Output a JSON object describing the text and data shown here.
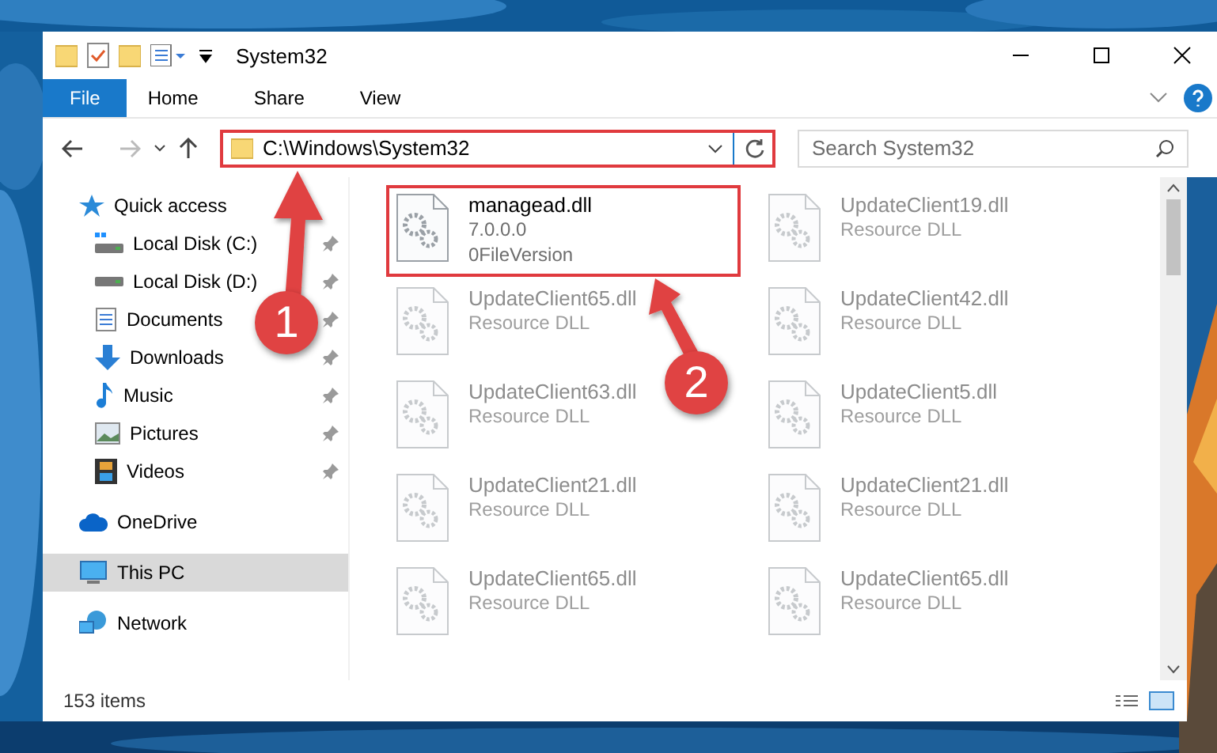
{
  "window": {
    "title": "System32"
  },
  "ribbon_tabs": [
    {
      "label": "File",
      "kind": "menu",
      "selected": false
    },
    {
      "label": "Home",
      "kind": "tab",
      "selected": false
    },
    {
      "label": "Share",
      "kind": "tab",
      "selected": false
    },
    {
      "label": "View",
      "kind": "tab",
      "selected": false
    }
  ],
  "address": {
    "path": "C:\\Windows\\System32",
    "highlighted": true
  },
  "search": {
    "placeholder": "Search System32"
  },
  "sidebar": {
    "items": [
      {
        "label": "Quick access",
        "selected": false,
        "children": [
          {
            "label": "Local Disk (C:)",
            "pinned": true,
            "selected": false
          },
          {
            "label": "Local Disk (D:)",
            "pinned": true,
            "selected": false
          },
          {
            "label": "Documents",
            "pinned": true,
            "selected": false
          },
          {
            "label": "Downloads",
            "pinned": true,
            "selected": false
          },
          {
            "label": "Music",
            "pinned": true,
            "selected": false
          },
          {
            "label": "Pictures",
            "pinned": true,
            "selected": false
          },
          {
            "label": "Videos",
            "pinned": true,
            "selected": false
          }
        ]
      },
      {
        "label": "OneDrive",
        "selected": false
      },
      {
        "label": "This PC",
        "selected": true
      },
      {
        "label": "Network",
        "selected": false
      }
    ]
  },
  "files": [
    {
      "name": "managead.dll",
      "details": [
        "7.0.0.0",
        "0FileVersion"
      ],
      "highlighted": true,
      "blurred": false
    },
    {
      "name": "UpdateClient19.dll",
      "details": [
        "Resource DLL"
      ],
      "highlighted": false,
      "blurred": true
    },
    {
      "name": "UpdateClient65.dll",
      "details": [
        "Resource DLL"
      ],
      "highlighted": false,
      "blurred": true
    },
    {
      "name": "UpdateClient42.dll",
      "details": [
        "Resource DLL"
      ],
      "highlighted": false,
      "blurred": true
    },
    {
      "name": "UpdateClient63.dll",
      "details": [
        "Resource DLL"
      ],
      "highlighted": false,
      "blurred": true
    },
    {
      "name": "UpdateClient5.dll",
      "details": [
        "Resource DLL"
      ],
      "highlighted": false,
      "blurred": true
    },
    {
      "name": "UpdateClient21.dll",
      "details": [
        "Resource DLL"
      ],
      "highlighted": false,
      "blurred": true
    },
    {
      "name": "UpdateClient21.dll",
      "details": [
        "Resource DLL"
      ],
      "highlighted": false,
      "blurred": true
    },
    {
      "name": "UpdateClient65.dll",
      "details": [
        "Resource DLL"
      ],
      "highlighted": false,
      "blurred": true
    },
    {
      "name": "UpdateClient65.dll",
      "details": [
        "Resource DLL"
      ],
      "highlighted": false,
      "blurred": true
    }
  ],
  "status_bar": {
    "count": "153 items"
  },
  "annotations": [
    {
      "label": "1"
    },
    {
      "label": "2"
    }
  ]
}
